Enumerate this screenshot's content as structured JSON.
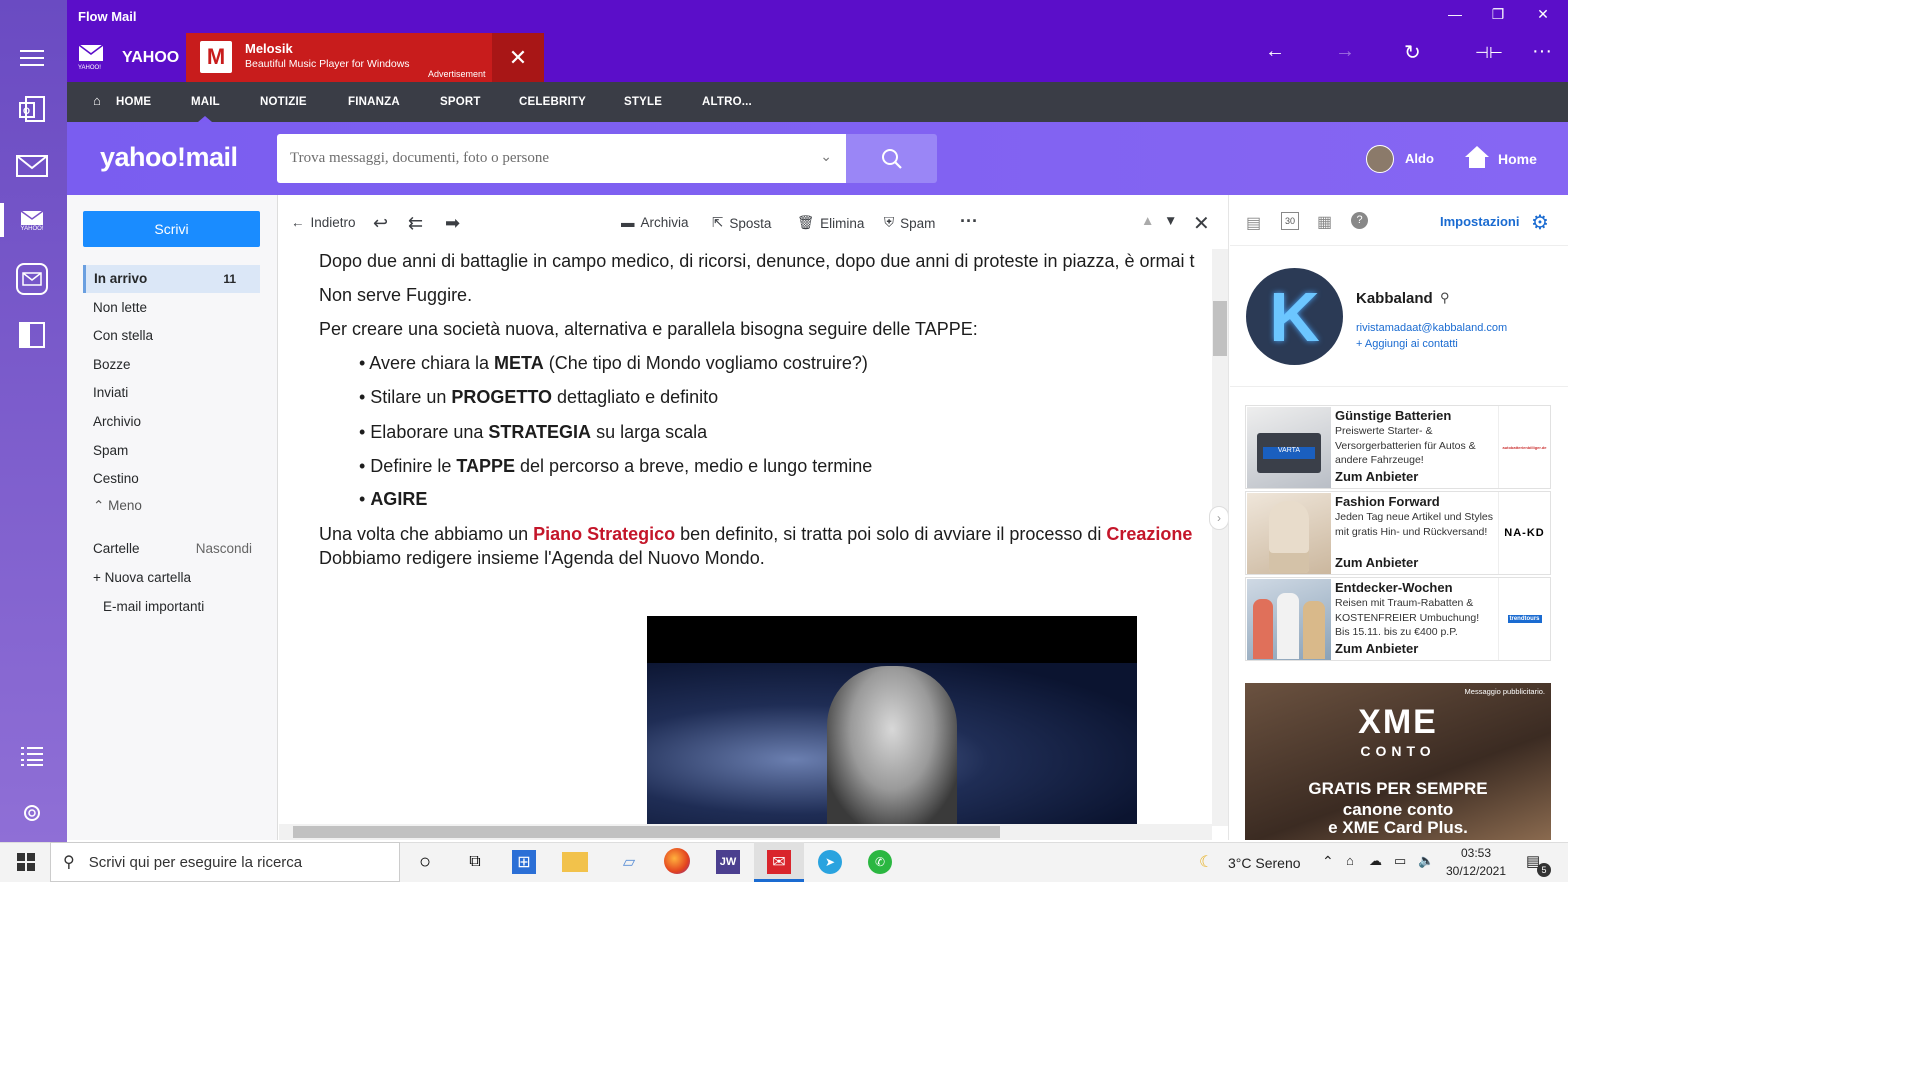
{
  "window": {
    "title": "Flow Mail"
  },
  "top_bar": {
    "yahoo_label": "YAHOO",
    "yahoo_tile_caption": "YAHOO!",
    "ad": {
      "title": "Melosik",
      "subtitle": "Beautiful Music Player for Windows",
      "tag": "Advertisement"
    }
  },
  "nav": {
    "items": [
      "HOME",
      "MAIL",
      "NOTIZIE",
      "FINANZA",
      "SPORT",
      "CELEBRITY",
      "STYLE",
      "ALTRO..."
    ]
  },
  "header": {
    "logo": "yahoo!mail",
    "search_placeholder": "Trova messaggi, documenti, foto o persone",
    "user_name": "Aldo",
    "home_label": "Home"
  },
  "sidebar": {
    "compose_label": "Scrivi",
    "folders": [
      {
        "label": "In arrivo",
        "count": "11"
      },
      {
        "label": "Non lette"
      },
      {
        "label": "Con stella"
      },
      {
        "label": "Bozze"
      },
      {
        "label": "Inviati"
      },
      {
        "label": "Archivio"
      },
      {
        "label": "Spam"
      },
      {
        "label": "Cestino"
      }
    ],
    "less_label": "Meno",
    "folders_header": "Cartelle",
    "hide_label": "Nascondi",
    "new_folder_label": "Nuova cartella",
    "custom_folder": "E-mail importanti"
  },
  "toolbar": {
    "back_label": "Indietro",
    "archive_label": "Archivia",
    "move_label": "Sposta",
    "delete_label": "Elimina",
    "spam_label": "Spam"
  },
  "message": {
    "line1": "Dopo due anni di battaglie in campo medico, di ricorsi, denunce, dopo due anni di proteste in piazza, è ormai t",
    "line2": "Non serve Fuggire.",
    "line3": "Per creare una società nuova, alternativa e parallela bisogna seguire delle TAPPE:",
    "bullets": [
      {
        "pre": "• Avere chiara la ",
        "bold": "META",
        "post": " (Che tipo di Mondo vogliamo costruire?)"
      },
      {
        "pre": "• Stilare un ",
        "bold": "PROGETTO",
        "post": " dettagliato e definito"
      },
      {
        "pre": "• Elaborare una ",
        "bold": "STRATEGIA",
        "post": " su larga scala"
      },
      {
        "pre": "• Definire le ",
        "bold": "TAPPE",
        "post": " del percorso a breve, medio e lungo termine"
      },
      {
        "pre": "• ",
        "bold": "AGIRE",
        "post": ""
      }
    ],
    "line4_pre": "Una volta che abbiamo un ",
    "line4_red1": "Piano Strategico",
    "line4_mid": " ben definito, si tratta poi solo di avviare il processo di ",
    "line4_red2": "Creazione",
    "line5": "Dobbiamo redigere insieme l'Agenda del Nuovo Mondo."
  },
  "right_panel": {
    "settings_label": "Impostazioni",
    "calendar_day": "30",
    "contact": {
      "name": "Kabbaland",
      "email": "rivistamadaat@kabbaland.com",
      "add_label": "+ Aggiungi ai contatti"
    },
    "ads": [
      {
        "title": "Günstige Batterien",
        "desc": "Preiswerte Starter- & Versorgerbatterien für Autos & andere Fahrzeuge!",
        "cta": "Zum Anbieter",
        "logo": "autobatterienbilliger.de"
      },
      {
        "title": "Fashion Forward",
        "desc": "Jeden Tag neue Artikel und Styles mit gratis Hin- und Rückversand!",
        "cta": "Zum Anbieter",
        "logo": "NA-KD"
      },
      {
        "title": "Entdecker-Wochen",
        "desc": "Reisen mit Traum-Rabatten & KOSTENFREIER Umbuchung! Bis 15.11. bis zu €400 p.P.",
        "cta": "Zum Anbieter",
        "logo": "trendtours"
      }
    ],
    "big_ad": {
      "note": "Messaggio pubblicitario.",
      "brand": "XME",
      "brand_sub": "CONTO",
      "line1": "GRATIS PER SEMPRE",
      "line2": "canone conto",
      "line3": "e XME Card Plus."
    }
  },
  "taskbar": {
    "search_placeholder": "Scrivi qui per eseguire la ricerca",
    "weather": "3°C  Sereno",
    "time": "03:53",
    "date": "30/12/2021",
    "notifications": "5",
    "jw_label": "JW"
  },
  "colors": {
    "title_bar": "#5b0ec9",
    "header": "#7c5cf2",
    "nav": "#3a3d46",
    "compose": "#1a8cff",
    "ad_red": "#c81c1c",
    "link": "#1a6bd1"
  }
}
